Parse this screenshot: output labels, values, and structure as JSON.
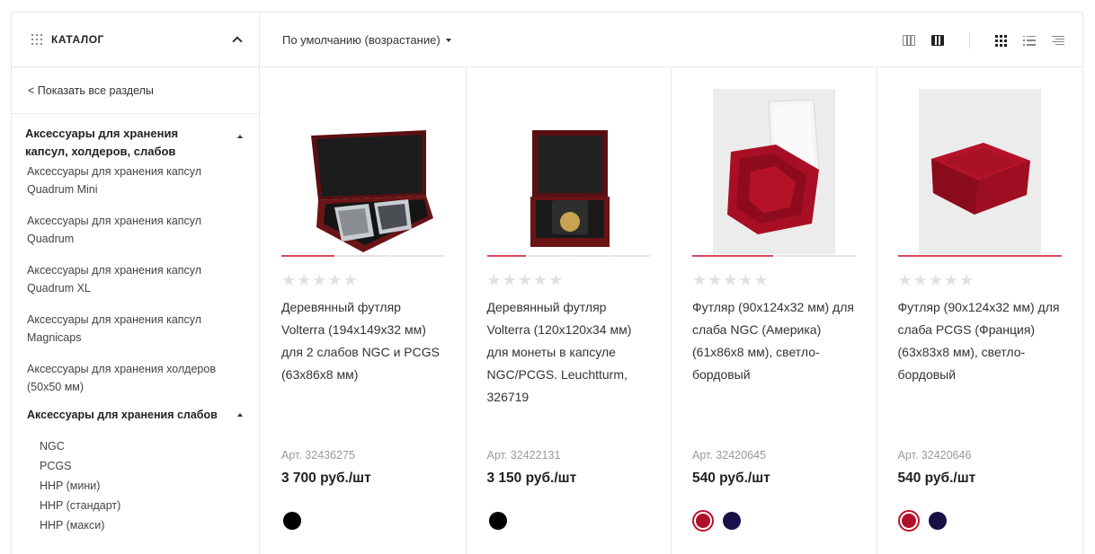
{
  "sidebar": {
    "title": "КАТАЛОГ",
    "show_all": "< Показать все разделы",
    "section1_title": "Аксессуары для хранения капсул, холдеров, слабов",
    "section1_items": [
      "Аксессуары для хранения капсул Quadrum Mini",
      "Аксессуары для хранения капсул Quadrum",
      "Аксессуары для хранения капсул Quadrum XL",
      "Аксессуары для хранения капсул Magnicaps",
      "Аксессуары для хранения холдеров (50x50 мм)"
    ],
    "section2_title": "Аксессуары для хранения слабов",
    "section2_items": [
      "NGC",
      "PCGS",
      "HHP (мини)",
      "HHP (стандарт)",
      "HHP (макси)"
    ]
  },
  "toolbar": {
    "sort_label": "По умолчанию (возрастание)"
  },
  "products": [
    {
      "title": "Деревянный футляр Volterra (194x149x32 мм) для 2 слабов NGC и PCGS (63x86x8 мм)",
      "article": "Арт. 32436275",
      "price": "3 700 руб./шт",
      "image": "wooden-case-two-slabs",
      "gallery_active": 1,
      "gallery_count": 3,
      "swatches": [
        {
          "color": "#000000",
          "selected": false
        }
      ]
    },
    {
      "title": "Деревянный футляр Volterra (120x120x34 мм) для монеты в капсуле NGC/PCGS. Leuchtturm, 326719",
      "article": "Арт. 32422131",
      "price": "3 150 руб./шт",
      "image": "wooden-case-single-slab",
      "gallery_active": 1,
      "gallery_count": 4,
      "swatches": [
        {
          "color": "#000000",
          "selected": false
        }
      ]
    },
    {
      "title": "Футляр (90x124x32 мм) для слаба NGC (Америка) (61x86x8 мм), светло-бордовый",
      "article": "Арт. 32420645",
      "price": "540 руб./шт",
      "image": "velvet-case-open",
      "gallery_active": 1,
      "gallery_count": 2,
      "swatches": [
        {
          "color": "#b0102a",
          "selected": true
        },
        {
          "color": "#1a1048",
          "selected": false
        }
      ]
    },
    {
      "title": "Футляр (90x124x32 мм) для слаба PCGS (Франция) (63x83x8 мм), светло-бордовый",
      "article": "Арт. 32420646",
      "price": "540 руб./шт",
      "image": "velvet-case-closed",
      "gallery_active": 1,
      "gallery_count": 1,
      "swatches": [
        {
          "color": "#b0102a",
          "selected": true
        },
        {
          "color": "#1a1048",
          "selected": false
        }
      ]
    }
  ],
  "colors": {
    "accent": "#d9475e",
    "star": "#e1e1e1"
  }
}
